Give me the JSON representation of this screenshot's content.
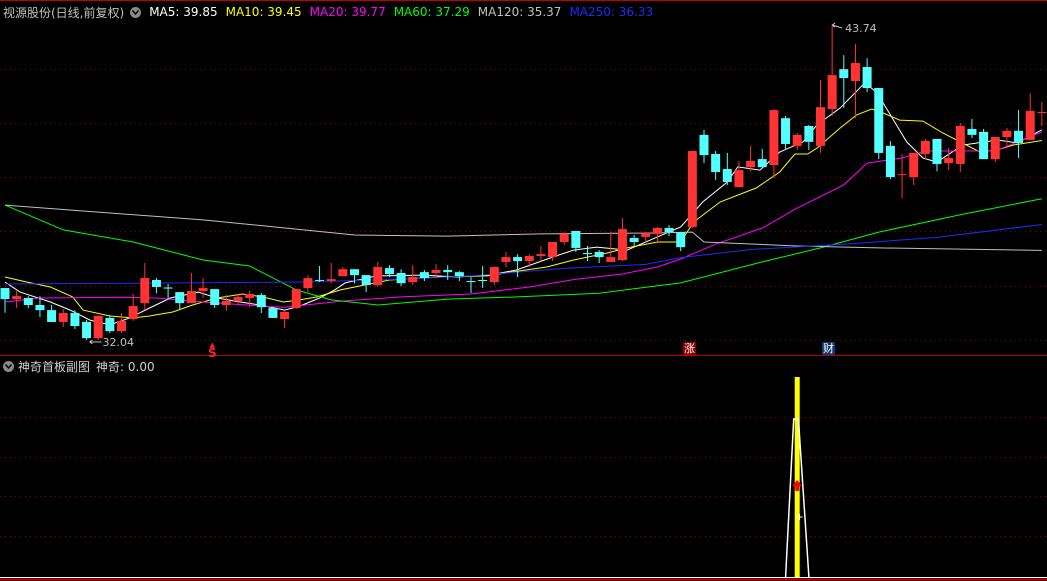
{
  "main_header": {
    "title": "视源股份(日线,前复权)",
    "indicators": [
      {
        "label": "MA5: 39.85",
        "color": "#ffffff"
      },
      {
        "label": "MA10: 39.45",
        "color": "#ffff00"
      },
      {
        "label": "MA20: 39.77",
        "color": "#ff00ff"
      },
      {
        "label": "MA60: 37.29",
        "color": "#00ff00"
      },
      {
        "label": "MA120: 35.37",
        "color": "#c0c0c0"
      },
      {
        "label": "MA250: 36.33",
        "color": "#1a2cff"
      }
    ]
  },
  "sub_header": {
    "title": "神奇首板副图",
    "value_label": "神奇: 0.00"
  },
  "markers": {
    "s_marker": "S",
    "zhang": "涨",
    "cai": "财"
  },
  "annotations": {
    "high_label": "43.74",
    "low_label": "32.04"
  },
  "colors": {
    "up": "#ff3333",
    "down": "#54ffff",
    "grid": "#8b0000",
    "border": "#c00000"
  },
  "chart_data": {
    "type": "candlestick",
    "ohlc_order": [
      "open",
      "high",
      "low",
      "close"
    ],
    "high_index": 71,
    "low_index": 7,
    "candles": [
      [
        33.97,
        33.97,
        33.05,
        33.56
      ],
      [
        33.56,
        33.86,
        33.23,
        33.67
      ],
      [
        33.6,
        33.67,
        33.23,
        33.34
      ],
      [
        33.34,
        33.67,
        32.89,
        33.15
      ],
      [
        33.15,
        33.34,
        32.71,
        32.71
      ],
      [
        32.71,
        33.19,
        32.52,
        33.04
      ],
      [
        33.04,
        33.15,
        32.45,
        32.56
      ],
      [
        32.71,
        32.78,
        32.04,
        32.11
      ],
      [
        32.11,
        32.97,
        32.04,
        32.93
      ],
      [
        32.86,
        32.97,
        32.3,
        32.37
      ],
      [
        32.37,
        33.04,
        32.3,
        32.75
      ],
      [
        32.82,
        33.76,
        32.75,
        33.3
      ],
      [
        33.41,
        34.9,
        33.15,
        34.34
      ],
      [
        34.27,
        34.34,
        33.78,
        34.01
      ],
      [
        33.99,
        34.12,
        33.53,
        33.95
      ],
      [
        33.82,
        33.82,
        33.15,
        33.41
      ],
      [
        33.41,
        34.53,
        33.41,
        33.86
      ],
      [
        33.86,
        34.34,
        33.6,
        33.97
      ],
      [
        33.93,
        33.93,
        33.23,
        33.34
      ],
      [
        33.34,
        33.71,
        33.12,
        33.49
      ],
      [
        33.49,
        33.75,
        33.38,
        33.64
      ],
      [
        33.6,
        33.86,
        33.26,
        33.75
      ],
      [
        33.71,
        33.78,
        33.04,
        33.26
      ],
      [
        33.23,
        33.23,
        32.86,
        32.86
      ],
      [
        32.82,
        33.19,
        32.49,
        33.08
      ],
      [
        33.23,
        33.93,
        33.19,
        33.93
      ],
      [
        33.97,
        34.45,
        33.82,
        34.34
      ],
      [
        34.27,
        34.79,
        34.19,
        34.23
      ],
      [
        34.23,
        34.9,
        34.15,
        34.3
      ],
      [
        34.41,
        34.75,
        34.41,
        34.67
      ],
      [
        34.67,
        34.67,
        34.15,
        34.45
      ],
      [
        34.45,
        34.45,
        33.82,
        34.08
      ],
      [
        34.08,
        34.94,
        34.01,
        34.75
      ],
      [
        34.71,
        34.82,
        34.38,
        34.49
      ],
      [
        34.53,
        34.67,
        34.04,
        34.15
      ],
      [
        34.19,
        34.82,
        34.08,
        34.38
      ],
      [
        34.56,
        34.64,
        34.23,
        34.34
      ],
      [
        34.53,
        34.86,
        34.34,
        34.64
      ],
      [
        34.64,
        34.82,
        34.27,
        34.56
      ],
      [
        34.56,
        34.6,
        34.23,
        34.41
      ],
      [
        34.23,
        34.38,
        33.78,
        34.19
      ],
      [
        34.27,
        34.79,
        33.97,
        34.23
      ],
      [
        34.19,
        34.75,
        34.08,
        34.75
      ],
      [
        34.94,
        35.31,
        34.75,
        35.12
      ],
      [
        35.12,
        35.23,
        34.38,
        34.97
      ],
      [
        34.97,
        35.23,
        34.75,
        35.16
      ],
      [
        35.16,
        35.53,
        34.97,
        35.23
      ],
      [
        35.12,
        35.68,
        34.97,
        35.68
      ],
      [
        35.68,
        36.05,
        35.57,
        35.98
      ],
      [
        36.09,
        36.09,
        35.31,
        35.46
      ],
      [
        35.27,
        35.53,
        34.97,
        35.23
      ],
      [
        35.31,
        35.38,
        34.9,
        35.12
      ],
      [
        34.94,
        36.05,
        34.94,
        35.12
      ],
      [
        35.01,
        36.57,
        34.97,
        36.16
      ],
      [
        35.83,
        35.94,
        35.53,
        35.68
      ],
      [
        35.87,
        36.05,
        35.68,
        36.01
      ],
      [
        35.98,
        36.24,
        35.68,
        36.2
      ],
      [
        36.2,
        36.31,
        35.9,
        36.05
      ],
      [
        36.05,
        36.05,
        35.34,
        35.49
      ],
      [
        36.24,
        39.06,
        36.2,
        39.06
      ],
      [
        39.66,
        39.84,
        38.61,
        38.91
      ],
      [
        38.95,
        39.06,
        37.98,
        38.28
      ],
      [
        38.39,
        38.99,
        37.8,
        37.91
      ],
      [
        37.72,
        38.69,
        37.72,
        38.35
      ],
      [
        38.46,
        39.25,
        38.31,
        38.69
      ],
      [
        38.76,
        39.14,
        38.46,
        38.46
      ],
      [
        38.54,
        40.62,
        38.06,
        40.58
      ],
      [
        40.28,
        40.36,
        39.1,
        39.32
      ],
      [
        39.25,
        39.73,
        39.1,
        39.66
      ],
      [
        39.99,
        40.03,
        39.1,
        39.4
      ],
      [
        39.25,
        41.7,
        38.99,
        40.69
      ],
      [
        40.62,
        43.74,
        40.36,
        41.88
      ],
      [
        42.1,
        42.62,
        40.66,
        41.77
      ],
      [
        41.66,
        43.04,
        40.28,
        42.33
      ],
      [
        42.18,
        42.51,
        41.25,
        41.4
      ],
      [
        41.4,
        41.4,
        38.76,
        38.99
      ],
      [
        39.25,
        39.43,
        38.02,
        38.09
      ],
      [
        38.2,
        38.95,
        37.31,
        38.2
      ],
      [
        38.09,
        38.99,
        37.8,
        38.99
      ],
      [
        38.95,
        39.51,
        38.76,
        39.43
      ],
      [
        39.51,
        39.51,
        38.31,
        38.58
      ],
      [
        38.61,
        39.17,
        38.35,
        38.8
      ],
      [
        38.58,
        40.1,
        38.28,
        39.99
      ],
      [
        39.88,
        40.25,
        39.54,
        39.66
      ],
      [
        39.77,
        39.88,
        38.76,
        38.76
      ],
      [
        38.76,
        39.58,
        38.65,
        39.58
      ],
      [
        39.58,
        39.92,
        39.25,
        39.81
      ],
      [
        39.81,
        40.58,
        38.8,
        39.36
      ],
      [
        39.47,
        41.21,
        39.47,
        40.55
      ],
      [
        40.51,
        40.88,
        39.99,
        40.51
      ]
    ],
    "moving_averages": [
      {
        "name": "MA5",
        "color": "#ffffff",
        "points": [
          [
            0,
            34.19
          ],
          [
            1.3,
            33.82
          ],
          [
            3.9,
            33.45
          ],
          [
            5.6,
            33.15
          ],
          [
            7.3,
            32.78
          ],
          [
            9,
            32.6
          ],
          [
            10.7,
            32.86
          ],
          [
            12.4,
            33.23
          ],
          [
            14.2,
            33.6
          ],
          [
            16.6,
            33.82
          ],
          [
            18.2,
            33.6
          ],
          [
            20.2,
            33.45
          ],
          [
            21.9,
            33.34
          ],
          [
            24,
            33.15
          ],
          [
            25.3,
            33.3
          ],
          [
            27,
            33.6
          ],
          [
            28.3,
            33.9
          ],
          [
            29.2,
            34.16
          ],
          [
            31.9,
            34.42
          ],
          [
            35.9,
            34.45
          ],
          [
            38.8,
            34.38
          ],
          [
            41.6,
            34.45
          ],
          [
            43.9,
            34.64
          ],
          [
            47,
            35.12
          ],
          [
            48.8,
            35.38
          ],
          [
            50.8,
            35.49
          ],
          [
            53.4,
            35.38
          ],
          [
            56,
            35.87
          ],
          [
            58,
            36.24
          ],
          [
            59.9,
            37.17
          ],
          [
            62,
            37.91
          ],
          [
            62.9,
            38.47
          ],
          [
            64.8,
            38.35
          ],
          [
            66.5,
            39.02
          ],
          [
            68.5,
            39.4
          ],
          [
            69.7,
            40.03
          ],
          [
            71.7,
            40.66
          ],
          [
            73.8,
            41.59
          ],
          [
            74.8,
            41.25
          ],
          [
            76,
            40.4
          ],
          [
            77.4,
            39.4
          ],
          [
            78.8,
            38.8
          ],
          [
            80,
            38.65
          ],
          [
            82.2,
            39.28
          ],
          [
            85.2,
            39.47
          ],
          [
            86.9,
            39.36
          ],
          [
            89,
            39.85
          ]
        ]
      },
      {
        "name": "MA10",
        "color": "#ffff00",
        "points": [
          [
            0,
            34.38
          ],
          [
            1.9,
            34.19
          ],
          [
            3.9,
            34.01
          ],
          [
            5.8,
            33.64
          ],
          [
            6.7,
            33.15
          ],
          [
            9,
            32.93
          ],
          [
            11,
            32.86
          ],
          [
            12.4,
            32.93
          ],
          [
            14.4,
            33.08
          ],
          [
            16.1,
            33.34
          ],
          [
            18.2,
            33.6
          ],
          [
            20.4,
            33.75
          ],
          [
            22.1,
            33.64
          ],
          [
            23.9,
            33.45
          ],
          [
            25.3,
            33.53
          ],
          [
            26.8,
            33.64
          ],
          [
            28.8,
            33.9
          ],
          [
            33,
            34.27
          ],
          [
            37.3,
            34.38
          ],
          [
            41.4,
            34.42
          ],
          [
            43.6,
            34.57
          ],
          [
            46.5,
            34.75
          ],
          [
            48.8,
            35.01
          ],
          [
            51.7,
            35.27
          ],
          [
            53.4,
            35.46
          ],
          [
            56,
            35.68
          ],
          [
            58,
            35.68
          ],
          [
            59.1,
            36.42
          ],
          [
            61.4,
            37.17
          ],
          [
            64.5,
            37.69
          ],
          [
            66.5,
            38.28
          ],
          [
            67.8,
            38.95
          ],
          [
            68.9,
            38.95
          ],
          [
            69.7,
            39.17
          ],
          [
            71.7,
            39.92
          ],
          [
            73.1,
            40.4
          ],
          [
            74.4,
            40.62
          ],
          [
            75.4,
            40.47
          ],
          [
            76.8,
            40.21
          ],
          [
            78.8,
            40.17
          ],
          [
            80.5,
            39.73
          ],
          [
            83.7,
            39.02
          ],
          [
            85.2,
            39.1
          ],
          [
            86.5,
            39.28
          ],
          [
            89,
            39.45
          ]
        ]
      },
      {
        "name": "MA20",
        "color": "#ff00ff",
        "points": [
          [
            0,
            33.45
          ],
          [
            3,
            33.6
          ],
          [
            10,
            33.63
          ],
          [
            13,
            33.6
          ],
          [
            17,
            33.45
          ],
          [
            22,
            33.3
          ],
          [
            24,
            33.26
          ],
          [
            29,
            33.49
          ],
          [
            34,
            33.64
          ],
          [
            40,
            33.75
          ],
          [
            45,
            34.01
          ],
          [
            49,
            34.3
          ],
          [
            53,
            34.49
          ],
          [
            56,
            34.75
          ],
          [
            58,
            35.05
          ],
          [
            61,
            35.6
          ],
          [
            65,
            36.2
          ],
          [
            68,
            36.94
          ],
          [
            72,
            37.8
          ],
          [
            74,
            38.61
          ],
          [
            77,
            38.8
          ],
          [
            79,
            39.06
          ],
          [
            85,
            39.06
          ],
          [
            89,
            39.77
          ]
        ]
      },
      {
        "name": "MA60",
        "color": "#00ff00",
        "points": [
          [
            0,
            37.05
          ],
          [
            5,
            36.13
          ],
          [
            11,
            35.68
          ],
          [
            17,
            35.01
          ],
          [
            21,
            34.79
          ],
          [
            25,
            33.9
          ],
          [
            28,
            33.53
          ],
          [
            32,
            33.34
          ],
          [
            38,
            33.56
          ],
          [
            44,
            33.64
          ],
          [
            51,
            33.78
          ],
          [
            58,
            34.16
          ],
          [
            65,
            34.94
          ],
          [
            70,
            35.46
          ],
          [
            75,
            36.05
          ],
          [
            82,
            36.69
          ],
          [
            89,
            37.29
          ]
        ]
      },
      {
        "name": "MA120",
        "color": "#c0c0c0",
        "points": [
          [
            0,
            37.05
          ],
          [
            8,
            36.79
          ],
          [
            17,
            36.5
          ],
          [
            25,
            36.16
          ],
          [
            30,
            35.94
          ],
          [
            38,
            35.9
          ],
          [
            46,
            35.98
          ],
          [
            55,
            36.01
          ],
          [
            59,
            36.05
          ],
          [
            60,
            35.68
          ],
          [
            68,
            35.53
          ],
          [
            75,
            35.46
          ],
          [
            89,
            35.37
          ]
        ]
      },
      {
        "name": "MA250",
        "color": "#1a2cff",
        "points": [
          [
            0,
            34.12
          ],
          [
            16,
            34.16
          ],
          [
            25,
            34.19
          ],
          [
            34,
            34.3
          ],
          [
            40,
            34.42
          ],
          [
            48,
            34.7
          ],
          [
            55,
            34.85
          ],
          [
            58,
            35.1
          ],
          [
            64,
            35.4
          ],
          [
            72,
            35.6
          ],
          [
            80,
            35.85
          ],
          [
            89,
            36.33
          ]
        ]
      }
    ],
    "sub_indicator": {
      "range": [
        0,
        1
      ],
      "bar": {
        "index": 68,
        "value": 1.0,
        "color": "#ffff00"
      },
      "line": {
        "color": "#ffffff",
        "points": [
          [
            67,
            0
          ],
          [
            67.7,
            0.79
          ],
          [
            68.1,
            0.79
          ],
          [
            69,
            0
          ]
        ]
      },
      "arrow_index": 68,
      "arrow_value": 0.45,
      "cross_index": 68.2,
      "cross_value": 0.3
    }
  }
}
